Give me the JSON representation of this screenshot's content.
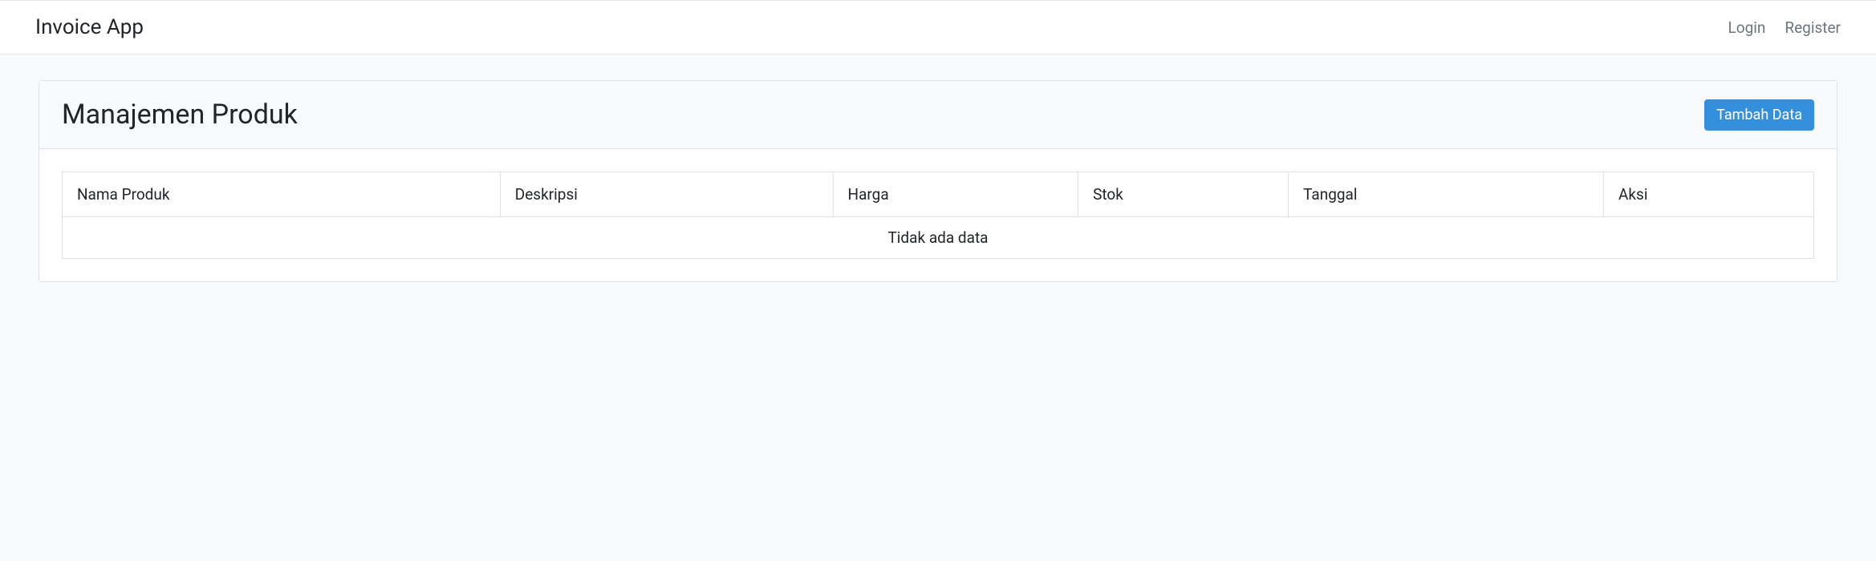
{
  "navbar": {
    "brand": "Invoice App",
    "links": {
      "login": "Login",
      "register": "Register"
    }
  },
  "card": {
    "title": "Manajemen Produk",
    "add_button": "Tambah Data"
  },
  "table": {
    "columns": {
      "nama": "Nama Produk",
      "deskripsi": "Deskripsi",
      "harga": "Harga",
      "stok": "Stok",
      "tanggal": "Tanggal",
      "aksi": "Aksi"
    },
    "empty_message": "Tidak ada data"
  }
}
